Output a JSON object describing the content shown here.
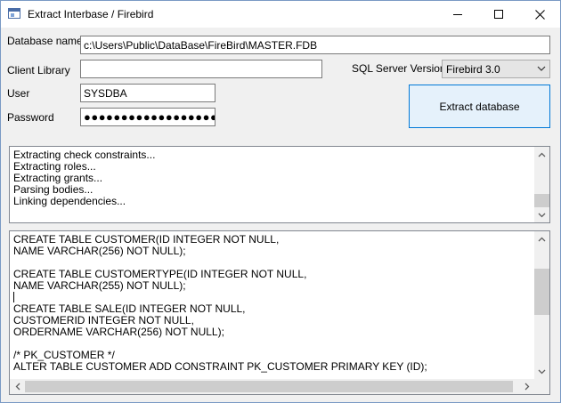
{
  "window": {
    "title": "Extract Interbase / Firebird",
    "minimize_icon": "minimize-icon",
    "maximize_icon": "maximize-icon",
    "close_icon": "close-icon"
  },
  "form": {
    "database_name_label": "Database name",
    "database_name_value": "c:\\Users\\Public\\DataBase\\FireBird\\MASTER.FDB",
    "client_library_label": "Client Library",
    "client_library_value": "",
    "user_label": "User",
    "user_value": "SYSDBA",
    "password_label": "Password",
    "password_value": "●●●●●●●●●●●●●●●●●●●",
    "server_version_label": "SQL Server Version",
    "server_version_value": "Firebird 3.0",
    "extract_button_label": "Extract database"
  },
  "log": {
    "lines": "Extracting check constraints...\nExtracting roles...\nExtracting grants...\nParsing bodies...\nLinking dependencies..."
  },
  "sql": {
    "text": "CREATE TABLE CUSTOMER(ID INTEGER NOT NULL,\nNAME VARCHAR(256) NOT NULL);\n\nCREATE TABLE CUSTOMERTYPE(ID INTEGER NOT NULL,\nNAME VARCHAR(255) NOT NULL);\n\nCREATE TABLE SALE(ID INTEGER NOT NULL,\nCUSTOMERID INTEGER NOT NULL,\nORDERNAME VARCHAR(256) NOT NULL);\n\n/* PK_CUSTOMER */\nALTER TABLE CUSTOMER ADD CONSTRAINT PK_CUSTOMER PRIMARY KEY (ID);"
  }
}
